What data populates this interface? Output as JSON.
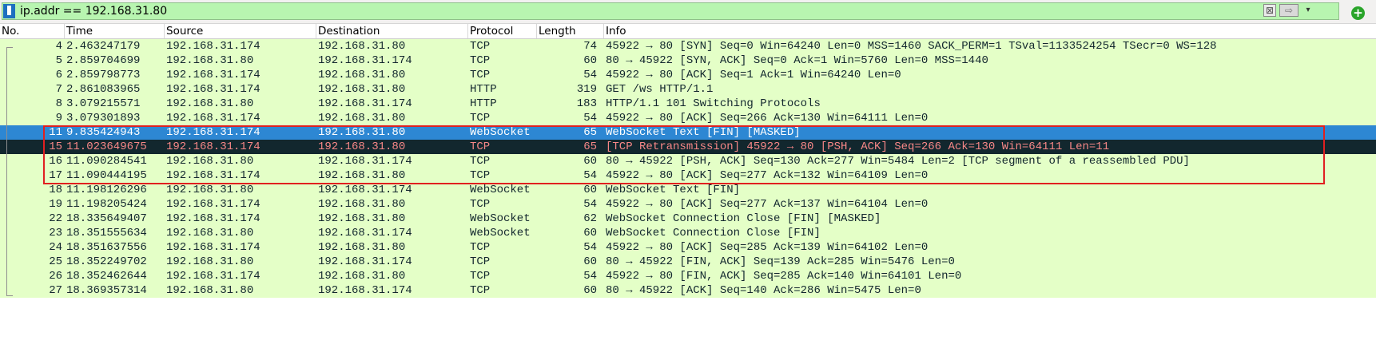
{
  "filter": {
    "value": "ip.addr == 192.168.31.80",
    "clear_label": "⊠",
    "apply_label": "⇨",
    "dropdown_label": "▾",
    "add_label": "+",
    "bg_color": "#b8f5b0"
  },
  "columns": [
    "No.",
    "Time",
    "Source",
    "Destination",
    "Protocol",
    "Length",
    "Info"
  ],
  "colors": {
    "row_green": "#e4ffc7",
    "row_selected": "#2d87d3",
    "row_dark": "#12272e",
    "row_dark_text": "#f78787",
    "highlight_border": "#e02020"
  },
  "packets": [
    {
      "no": "4",
      "time": "2.463247179",
      "src": "192.168.31.174",
      "dst": "192.168.31.80",
      "proto": "TCP",
      "len": "74",
      "info": "45922 → 80 [SYN] Seq=0 Win=64240 Len=0 MSS=1460 SACK_PERM=1 TSval=1133524254 TSecr=0 WS=128",
      "style": "green"
    },
    {
      "no": "5",
      "time": "2.859704699",
      "src": "192.168.31.80",
      "dst": "192.168.31.174",
      "proto": "TCP",
      "len": "60",
      "info": "80 → 45922 [SYN, ACK] Seq=0 Ack=1 Win=5760 Len=0 MSS=1440",
      "style": "green"
    },
    {
      "no": "6",
      "time": "2.859798773",
      "src": "192.168.31.174",
      "dst": "192.168.31.80",
      "proto": "TCP",
      "len": "54",
      "info": "45922 → 80 [ACK] Seq=1 Ack=1 Win=64240 Len=0",
      "style": "green"
    },
    {
      "no": "7",
      "time": "2.861083965",
      "src": "192.168.31.174",
      "dst": "192.168.31.80",
      "proto": "HTTP",
      "len": "319",
      "info": "GET /ws HTTP/1.1",
      "style": "green"
    },
    {
      "no": "8",
      "time": "3.079215571",
      "src": "192.168.31.80",
      "dst": "192.168.31.174",
      "proto": "HTTP",
      "len": "183",
      "info": "HTTP/1.1 101 Switching Protocols",
      "style": "green"
    },
    {
      "no": "9",
      "time": "3.079301893",
      "src": "192.168.31.174",
      "dst": "192.168.31.80",
      "proto": "TCP",
      "len": "54",
      "info": "45922 → 80 [ACK] Seq=266 Ack=130 Win=64111 Len=0",
      "style": "green"
    },
    {
      "no": "11",
      "time": "9.835424943",
      "src": "192.168.31.174",
      "dst": "192.168.31.80",
      "proto": "WebSocket",
      "len": "65",
      "info": "WebSocket Text [FIN] [MASKED]",
      "style": "selected"
    },
    {
      "no": "15",
      "time": "11.023649675",
      "src": "192.168.31.174",
      "dst": "192.168.31.80",
      "proto": "TCP",
      "len": "65",
      "info": "[TCP Retransmission] 45922 → 80 [PSH, ACK] Seq=266 Ack=130 Win=64111 Len=11",
      "style": "dark"
    },
    {
      "no": "16",
      "time": "11.090284541",
      "src": "192.168.31.80",
      "dst": "192.168.31.174",
      "proto": "TCP",
      "len": "60",
      "info": "80 → 45922 [PSH, ACK] Seq=130 Ack=277 Win=5484 Len=2 [TCP segment of a reassembled PDU]",
      "style": "green"
    },
    {
      "no": "17",
      "time": "11.090444195",
      "src": "192.168.31.174",
      "dst": "192.168.31.80",
      "proto": "TCP",
      "len": "54",
      "info": "45922 → 80 [ACK] Seq=277 Ack=132 Win=64109 Len=0",
      "style": "green"
    },
    {
      "no": "18",
      "time": "11.198126296",
      "src": "192.168.31.80",
      "dst": "192.168.31.174",
      "proto": "WebSocket",
      "len": "60",
      "info": "WebSocket Text [FIN]",
      "style": "green"
    },
    {
      "no": "19",
      "time": "11.198205424",
      "src": "192.168.31.174",
      "dst": "192.168.31.80",
      "proto": "TCP",
      "len": "54",
      "info": "45922 → 80 [ACK] Seq=277 Ack=137 Win=64104 Len=0",
      "style": "green"
    },
    {
      "no": "22",
      "time": "18.335649407",
      "src": "192.168.31.174",
      "dst": "192.168.31.80",
      "proto": "WebSocket",
      "len": "62",
      "info": "WebSocket Connection Close [FIN] [MASKED]",
      "style": "green"
    },
    {
      "no": "23",
      "time": "18.351555634",
      "src": "192.168.31.80",
      "dst": "192.168.31.174",
      "proto": "WebSocket",
      "len": "60",
      "info": "WebSocket Connection Close [FIN]",
      "style": "green"
    },
    {
      "no": "24",
      "time": "18.351637556",
      "src": "192.168.31.174",
      "dst": "192.168.31.80",
      "proto": "TCP",
      "len": "54",
      "info": "45922 → 80 [ACK] Seq=285 Ack=139 Win=64102 Len=0",
      "style": "green"
    },
    {
      "no": "25",
      "time": "18.352249702",
      "src": "192.168.31.80",
      "dst": "192.168.31.174",
      "proto": "TCP",
      "len": "60",
      "info": "80 → 45922 [FIN, ACK] Seq=139 Ack=285 Win=5476 Len=0",
      "style": "green"
    },
    {
      "no": "26",
      "time": "18.352462644",
      "src": "192.168.31.174",
      "dst": "192.168.31.80",
      "proto": "TCP",
      "len": "54",
      "info": "45922 → 80 [FIN, ACK] Seq=285 Ack=140 Win=64101 Len=0",
      "style": "green"
    },
    {
      "no": "27",
      "time": "18.369357314",
      "src": "192.168.31.80",
      "dst": "192.168.31.174",
      "proto": "TCP",
      "len": "60",
      "info": "80 → 45922 [ACK] Seq=140 Ack=286 Win=5475 Len=0",
      "style": "green"
    }
  ]
}
